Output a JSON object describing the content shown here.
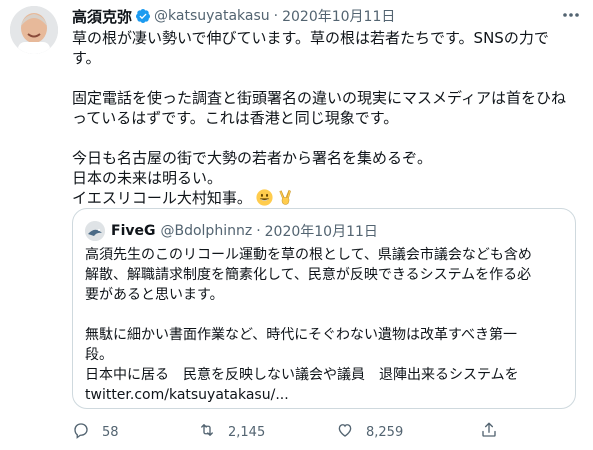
{
  "author": {
    "name": "高須克弥",
    "handle": "@katsuyatakasu",
    "separator": "·",
    "date": "2020年10月11日"
  },
  "tweet": {
    "paragraphs": [
      [
        "草の根が凄い勢いで伸びています。草の根は若者たちです。SNSの力で",
        "す。"
      ],
      [
        "固定電話を使った調査と街頭署名の違いの現実にマスメディアは首をひね",
        "っているはずです。これは香港と同じ現象です。"
      ],
      [
        "今日も名古屋の街で大勢の若者から署名を集めるぞ。",
        "日本の未来は明るい。",
        "イエスリコール大村知事。"
      ]
    ]
  },
  "quoted": {
    "name": "FiveG",
    "handle": "@Bdolphinnz",
    "separator": "·",
    "date": "2020年10月11日",
    "paragraphs": [
      [
        "高須先生のこのリコール運動を草の根として、県議会市議会なども含め",
        "解散、解職請求制度を簡素化して、民意が反映できるシステムを作る必",
        "要があると思います。"
      ],
      [
        "無駄に細かい書面作業など、時代にそぐわない遺物は改革すべき第一",
        "段。",
        "日本中に居る　民意を反映しない議会や議員　退陣出来るシステムを",
        "twitter.com/katsuyatakasu/..."
      ]
    ]
  },
  "actions": {
    "replies": "58",
    "retweets": "2,145",
    "likes": "8,259"
  },
  "colors": {
    "text": "#0f1419",
    "secondary": "#536471",
    "verified": "#1d9bf0",
    "border": "#cfd9de"
  }
}
